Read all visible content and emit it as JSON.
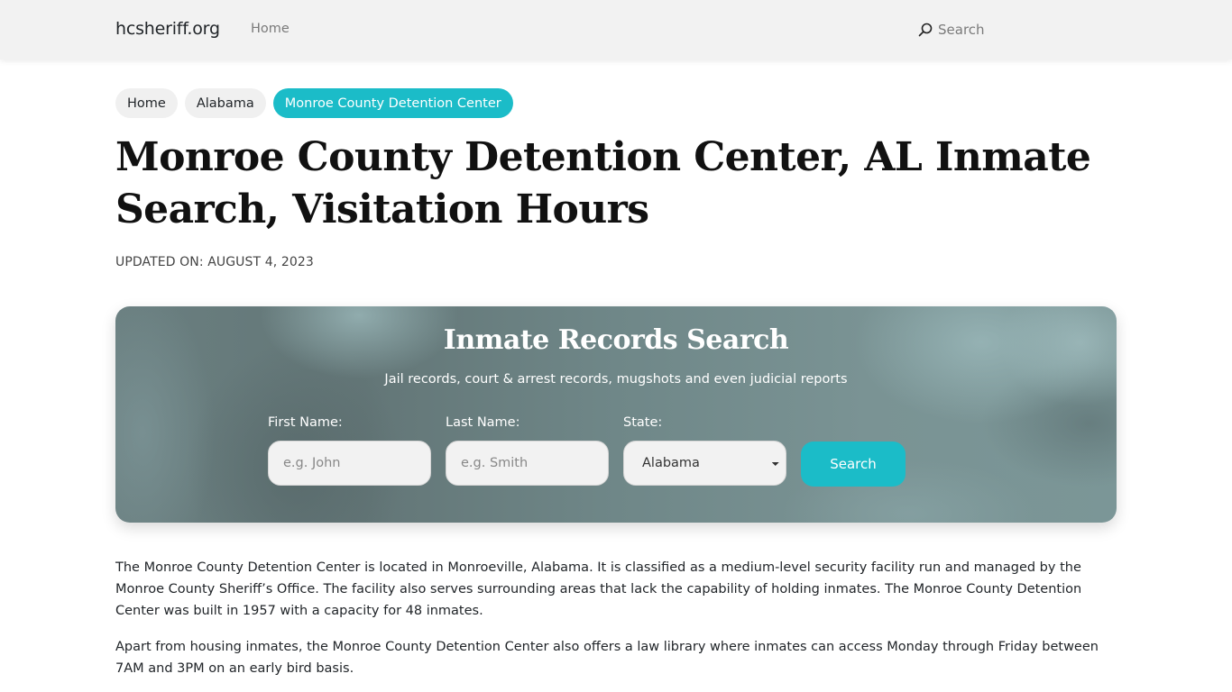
{
  "header": {
    "brand": "hcsheriff.org",
    "nav": [
      {
        "label": "Home"
      }
    ],
    "search_label": "Search",
    "search_icon": "search-icon"
  },
  "breadcrumb": [
    {
      "label": "Home",
      "active": false
    },
    {
      "label": "Alabama",
      "active": false
    },
    {
      "label": "Monroe County Detention Center",
      "active": true
    }
  ],
  "page": {
    "title": "Monroe County Detention Center, AL Inmate Search, Visitation Hours",
    "updated": "UPDATED ON: AUGUST 4, 2023"
  },
  "search_card": {
    "title": "Inmate Records Search",
    "subtitle": "Jail records, court & arrest records, mugshots and even judicial reports",
    "first_name": {
      "label": "First Name:",
      "placeholder": "e.g. John",
      "value": ""
    },
    "last_name": {
      "label": "Last Name:",
      "placeholder": "e.g. Smith",
      "value": ""
    },
    "state": {
      "label": "State:",
      "selected": "Alabama"
    },
    "button_label": "Search"
  },
  "content": {
    "paragraphs": [
      "The Monroe County Detention Center is located in Monroeville, Alabama. It is classified as a medium-level security facility run and managed by the Monroe County Sheriff’s Office. The facility also serves surrounding areas that lack the capability of holding inmates. The Monroe County Detention Center was built in 1957 with a capacity for 48 inmates.",
      "Apart from housing inmates, the Monroe County Detention Center also offers a law library where inmates can access Monday through Friday between 7AM and 3PM on an early bird basis."
    ]
  },
  "colors": {
    "accent": "#1bbcc8",
    "header_bg": "#f2f2f2",
    "crumb_bg": "#f0f0f0"
  }
}
